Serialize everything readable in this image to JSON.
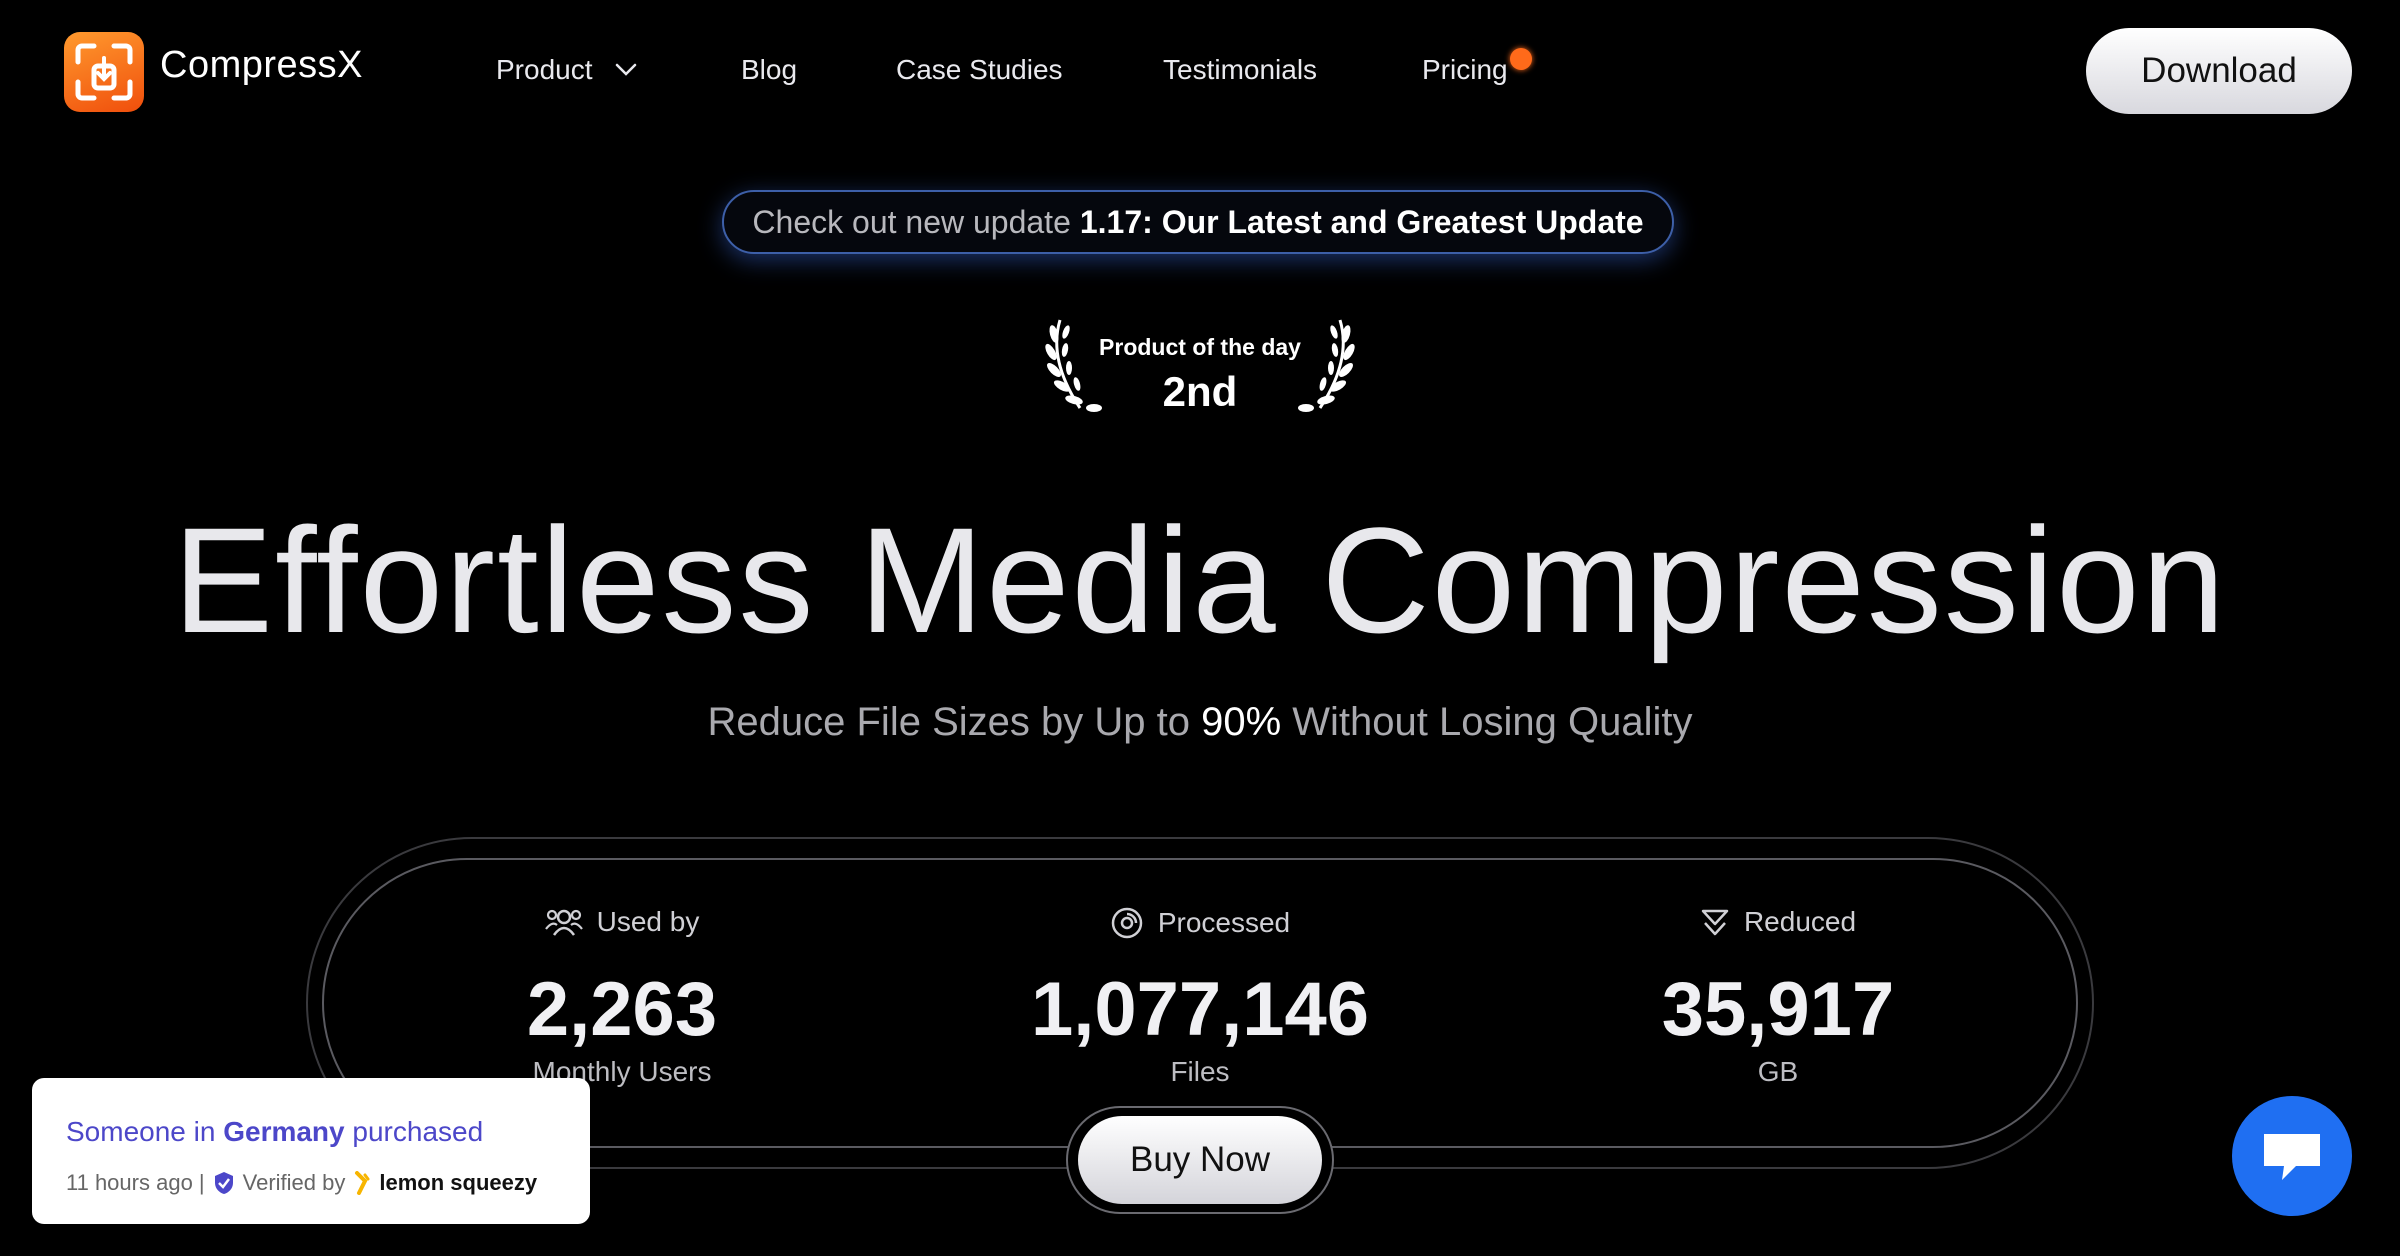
{
  "nav": {
    "brand": "CompressX",
    "items": [
      {
        "label": "Product",
        "has_dropdown": true
      },
      {
        "label": "Blog"
      },
      {
        "label": "Case Studies"
      },
      {
        "label": "Testimonials"
      },
      {
        "label": "Pricing",
        "has_notification_dot": true
      }
    ],
    "download_label": "Download"
  },
  "update_banner": {
    "prefix": "Check out new update",
    "highlight": "1.17: Our Latest and Greatest Update"
  },
  "award": {
    "title": "Product of the day",
    "rank": "2nd",
    "icon": "laurel-wreath-icon"
  },
  "hero": {
    "title": "Effortless Media Compression",
    "subtitle_before": "Reduce File Sizes by Up to",
    "subtitle_highlight": "90%",
    "subtitle_after": "Without Losing Quality"
  },
  "stats": [
    {
      "label": "Used by",
      "value": "2,263",
      "unit": "Monthly Users",
      "icon": "users-icon"
    },
    {
      "label": "Processed",
      "value": "1,077,146",
      "unit": "Files",
      "icon": "compress-disc-icon"
    },
    {
      "label": "Reduced",
      "value": "35,917",
      "unit": "GB",
      "icon": "reduce-arrow-icon"
    }
  ],
  "buy_label": "Buy Now",
  "toast": {
    "line_prefix": "Someone in",
    "country": "Germany",
    "line_suffix": "purchased",
    "time": "11 hours ago |",
    "verified": "Verified by",
    "provider": "lemon squeezy"
  },
  "colors": {
    "background": "#000000",
    "logo_gradient_start": "#ff9a2e",
    "logo_gradient_end": "#f04e0c",
    "notification_dot": "#ff6a1a",
    "banner_glow": "#3d5fa8",
    "toast_text": "#4c47c9",
    "chat_button": "#1f6ff2"
  }
}
